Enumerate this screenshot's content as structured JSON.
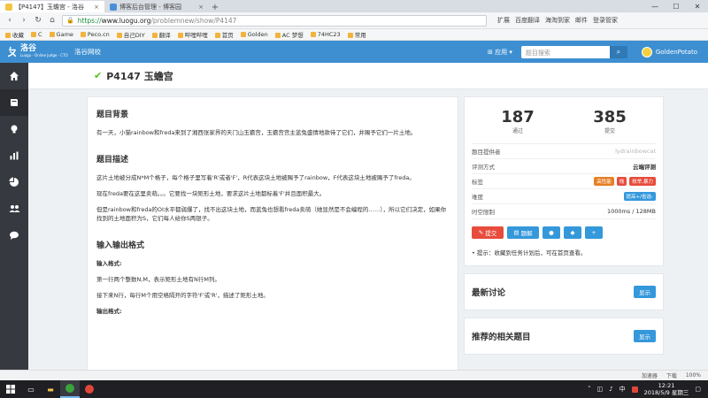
{
  "browser": {
    "tabs": [
      {
        "label": "【P4147】玉蟾宫 - 洛谷",
        "active": true
      },
      {
        "label": "博客后台管理 - 博客园",
        "active": false
      }
    ],
    "url": {
      "protocol": "https://",
      "host": "www.luogu.org",
      "path": "/problemnew/show/P4147"
    },
    "toolbar_items": [
      "扩展",
      "百度翻译",
      "海淘到家",
      "邮件",
      "登录管家"
    ],
    "bookmarks": [
      "收藏",
      "C",
      "Game",
      "Peco.cn",
      "自己DIY",
      "翻译",
      "哔哩哔哩",
      "首页",
      "Golden",
      "AC 梦想",
      "74HC23",
      "常用"
    ]
  },
  "site": {
    "logo_text": "洛谷",
    "logo_sub": "Luogu · Online Judge · CTO",
    "name": "洛谷网校",
    "app_menu": "应用",
    "search_placeholder": "题目搜索",
    "username": "GoldenPotato"
  },
  "sidebar": {
    "items": [
      {
        "icon": "home-icon"
      },
      {
        "icon": "book-icon"
      },
      {
        "icon": "bulb-icon"
      },
      {
        "icon": "bar-chart-icon"
      },
      {
        "icon": "pie-chart-icon"
      },
      {
        "icon": "users-icon"
      },
      {
        "icon": "chat-icon"
      }
    ]
  },
  "problem": {
    "title": "P4147 玉蟾宫",
    "sections": {
      "background_title": "题目背景",
      "background_text": "有一天，小猫rainbow和freda来到了湘西张家界的天门山玉蟾宫，玉蟾宫宫主蓝兔盛情地款待了它们，并赐予它们一片土地。",
      "description_title": "题目描述",
      "description_p1": "这片土地被分成N*M个格子，每个格子里写着'R'或者'F'，R代表这块土地被赐予了rainbow，F代表这块土地被赐予了freda。",
      "description_p2": "现在freda要在这里卖萌。。。它要找一块矩形土地，要求这片土地都标着'F'并且面积最大。",
      "description_p3": "但是rainbow和freda的OI水平都弱爆了，找不出这块土地，而蓝兔也想看freda卖萌（她显然是不会编程的……），所以它们决定，如果你找到的土地面积为S，它们每人给你S两银子。",
      "io_title": "输入输出格式",
      "input_label": "输入格式:",
      "input_p1": "第一行两个整数N,M，表示矩形土地有N行M列。",
      "input_p2": "接下来N行，每行M个用空格隔开的字符'F'或'R'，描述了矩形土地。",
      "output_label": "输出格式:"
    }
  },
  "stats": {
    "passed": "187",
    "passed_label": "通过",
    "submitted": "385",
    "submitted_label": "提交"
  },
  "info": {
    "provider_label": "题目提供者",
    "provider_value": "lydrainbowcat",
    "judge_label": "评测方式",
    "judge_value": "云端评测",
    "tags_label": "标签",
    "tags": [
      "高性能",
      "栈",
      "枚举,暴力"
    ],
    "difficulty_label": "难度",
    "difficulty_value": "提高+/省选-",
    "limit_label": "时空限制",
    "limit_value": "1000ms / 128MB"
  },
  "actions": {
    "submit": "提交",
    "solution": "题解"
  },
  "tip": "提示：收藏到任务计划后，可在首页查看。",
  "discussions": {
    "title": "最新讨论",
    "show": "显示"
  },
  "related": {
    "title": "推荐的相关题目",
    "show": "显示"
  },
  "statusbar": {
    "accelerator": "加速器",
    "download": "下载",
    "zoom": "100%"
  },
  "taskbar": {
    "ime": "中",
    "time": "12:21",
    "date": "2018/5/9 星期三"
  },
  "colors": {
    "nav": "#3d8fd1",
    "sidebar": "#36393f",
    "accept": "#52c41a",
    "submit": "#e74c3c",
    "primary": "#3498db"
  }
}
